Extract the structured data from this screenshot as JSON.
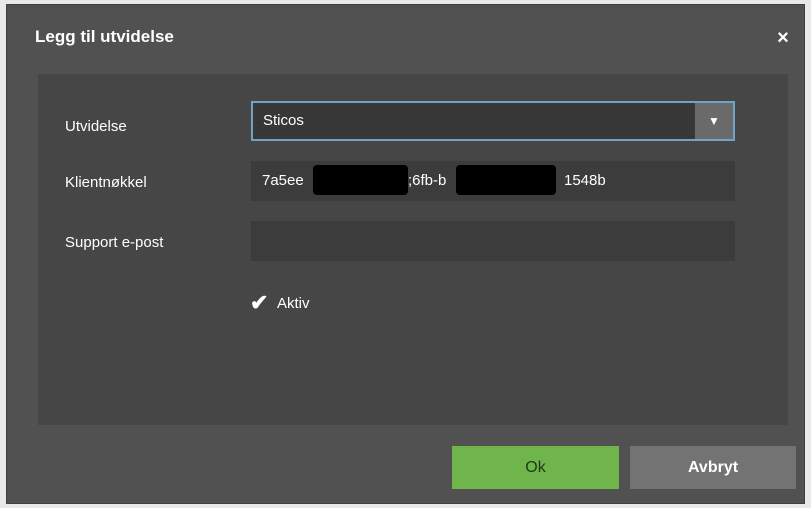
{
  "dialog": {
    "title": "Legg til utvidelse",
    "close_icon": "×"
  },
  "form": {
    "extension": {
      "label": "Utvidelse",
      "value": "Sticos",
      "arrow_icon": "▼"
    },
    "client_key": {
      "label": "Klientnøkkel",
      "value_part1": "7a5ee",
      "value_part2": ";6fb-b",
      "value_part3": "1548b"
    },
    "support_email": {
      "label": "Support e-post",
      "value": ""
    },
    "active": {
      "label": "Aktiv",
      "checked_icon": "✔",
      "checked": true
    }
  },
  "buttons": {
    "ok": "Ok",
    "cancel": "Avbryt"
  },
  "colors": {
    "dialog_bg": "#515151",
    "content_bg": "#464646",
    "field_bg": "#3c3c3c",
    "focus_border": "#6fa3c8",
    "ok_green": "#6fb54c",
    "cancel_gray": "#737373"
  }
}
